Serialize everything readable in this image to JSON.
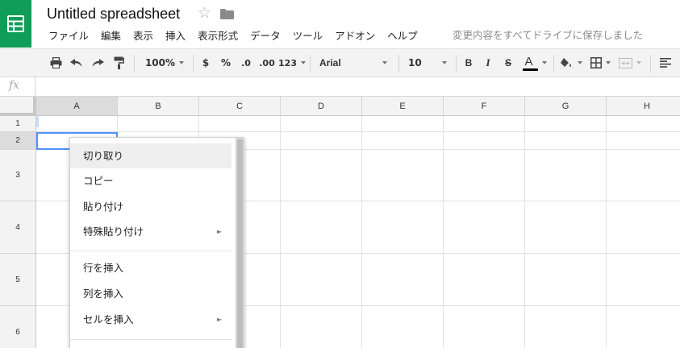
{
  "app": {
    "title": "Untitled spreadsheet",
    "logo_icon": "sheets-logo-icon",
    "brand_color": "#0f9d58",
    "save_status": "変更内容をすべてドライブに保存しました"
  },
  "menubar": {
    "items": [
      "ファイル",
      "編集",
      "表示",
      "挿入",
      "表示形式",
      "データ",
      "ツール",
      "アドオン",
      "ヘルプ"
    ]
  },
  "toolbar": {
    "zoom": "100%",
    "currency": "$",
    "percent": "%",
    "decrease_decimal": ".0",
    "increase_decimal": ".00",
    "number_format": "123",
    "font": "Arial",
    "font_size": "10",
    "bold": "B",
    "italic": "I",
    "strikethrough": "S",
    "text_color": "A",
    "icons": [
      "print-icon",
      "undo-icon",
      "redo-icon",
      "paint-format-icon",
      "fill-color-icon",
      "borders-icon",
      "merge-cells-icon",
      "align-icon"
    ]
  },
  "formula_bar": {
    "fx_label": "fx",
    "value": ""
  },
  "grid": {
    "columns": [
      "A",
      "B",
      "C",
      "D",
      "E",
      "F",
      "G",
      "H"
    ],
    "rows": [
      "1",
      "2",
      "3",
      "4",
      "5",
      "6"
    ],
    "selected_column": "A",
    "selected_row": "2",
    "selection_color": "#4d90fe"
  },
  "context_menu": {
    "items": [
      {
        "label": "切り取り",
        "submenu": false
      },
      {
        "label": "コピー",
        "submenu": false
      },
      {
        "label": "貼り付け",
        "submenu": false
      },
      {
        "label": "特殊貼り付け",
        "submenu": true
      },
      {
        "label": "行を挿入",
        "submenu": false
      },
      {
        "label": "列を挿入",
        "submenu": false
      },
      {
        "label": "セルを挿入",
        "submenu": true
      }
    ],
    "submenu_arrow": "►"
  }
}
